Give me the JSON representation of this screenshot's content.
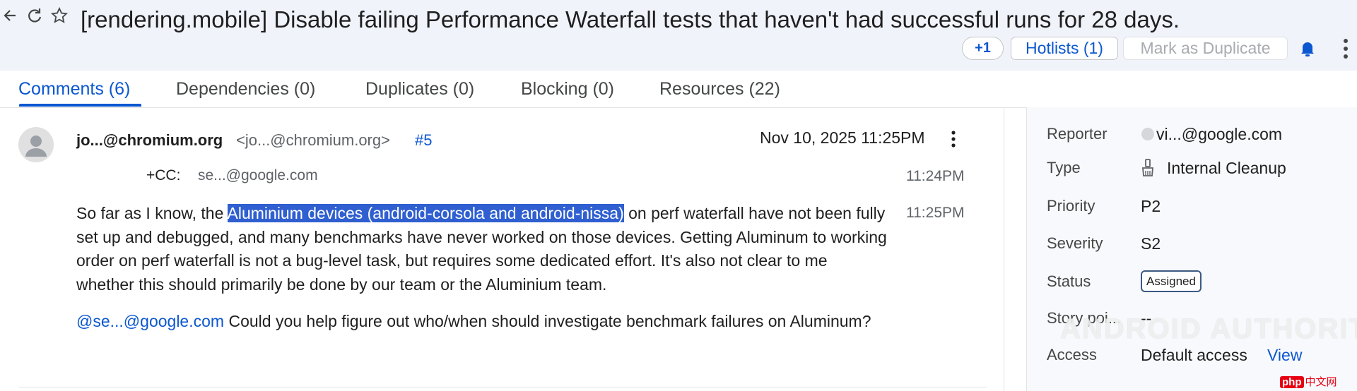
{
  "header": {
    "title": "[rendering.mobile] Disable failing Performance Waterfall tests that haven't had successful runs for 28 days.",
    "plus_one": "+1",
    "hotlists": "Hotlists (1)",
    "mark_duplicate": "Mark as Duplicate"
  },
  "tabs": [
    {
      "label": "Comments (6)"
    },
    {
      "label": "Dependencies (0)"
    },
    {
      "label": "Duplicates (0)"
    },
    {
      "label": "Blocking (0)"
    },
    {
      "label": "Resources (22)"
    }
  ],
  "comment": {
    "author": "jo...@chromium.org",
    "email": "<jo...@chromium.org>",
    "number": "#5",
    "date": "Nov 10, 2025 11:25PM",
    "cc_label": "+CC:",
    "cc_value": "se...@google.com",
    "cc_time": "11:24PM",
    "body_time": "11:25PM",
    "body_pre": "So far as I know, the ",
    "body_highlight": "Aluminium devices (android-corsola and android-nissa)",
    "body_post": " on perf waterfall have not been fully set up and debugged, and many benchmarks have never worked on those devices. Getting Aluminum to working order on perf waterfall is not a bug-level task, but requires some dedicated effort. It's also not clear to me whether this should primarily be done by our team or the Aluminium team.",
    "mention": "@se...@google.com",
    "body2": " Could you help figure out who/when should investigate benchmark failures on Aluminum?"
  },
  "sidebar": {
    "reporter_label": "Reporter",
    "reporter_value": "vi...@google.com",
    "type_label": "Type",
    "type_value": "Internal Cleanup",
    "priority_label": "Priority",
    "priority_value": "P2",
    "severity_label": "Severity",
    "severity_value": "S2",
    "status_label": "Status",
    "status_value": "Assigned",
    "story_label": "Story poi...",
    "story_value": "--",
    "access_label": "Access",
    "access_value": "Default access",
    "view_link": "View"
  },
  "watermark": "ANDROID AUTHORITY",
  "corner_logo": {
    "badge": "php",
    "text": "中文网"
  },
  "colors": {
    "accent": "#0b57d0",
    "highlight": "#2f5fd0",
    "header_bg": "#f1f3fb"
  }
}
